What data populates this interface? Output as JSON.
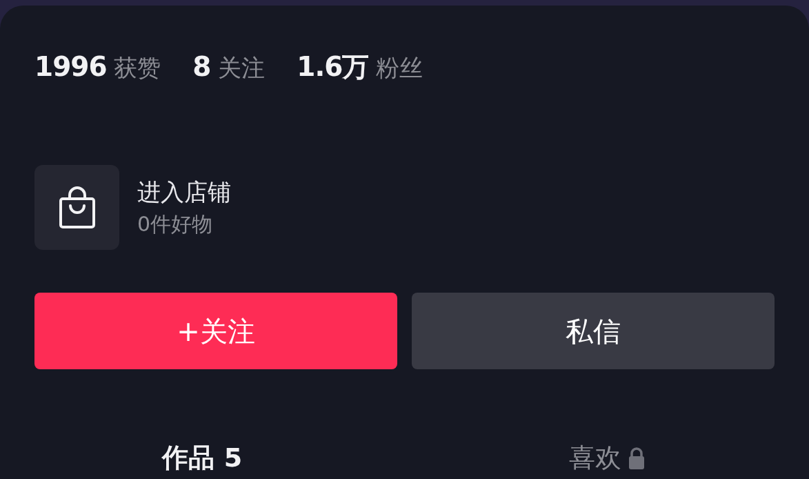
{
  "stats": [
    "**1996** 获赞",
    "**8** 关注",
    "**1.6万** 粉丝"
  ],
  "shop": {
    "title": "进入店铺",
    "subtitle": "0件好物"
  },
  "buttons": [
    {
      "label": "+关注",
      "kind": "primary"
    },
    {
      "label": "私信",
      "kind": "secondary"
    }
  ],
  "tabs": [
    {
      "label": "作品 5",
      "selected": true,
      "locked": false
    },
    {
      "label": "喜欢",
      "selected": false,
      "locked": true
    }
  ]
}
